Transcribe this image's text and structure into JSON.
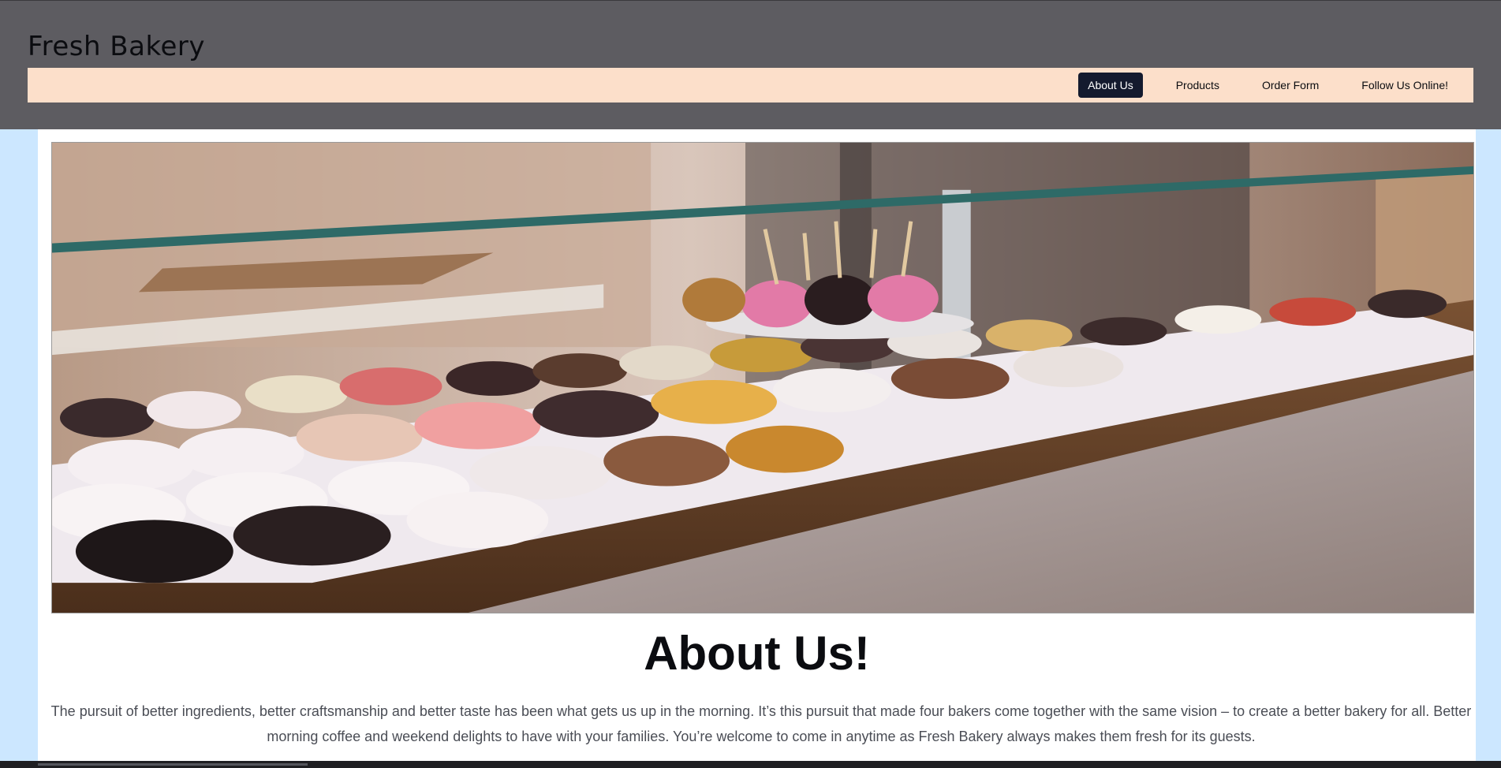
{
  "header": {
    "brand": "Fresh Bakery"
  },
  "nav": {
    "items": [
      {
        "label": "About Us",
        "active": true
      },
      {
        "label": "Products",
        "active": false
      },
      {
        "label": "Order Form",
        "active": false
      },
      {
        "label": "Follow Us Online!",
        "active": false
      }
    ]
  },
  "main": {
    "title": "About Us!",
    "intro": "The pursuit of better ingredients, better craftsmanship and better taste has been what gets us up in the morning. It’s this pursuit that made four bakers come together with the same vision – to create a better bakery for all. Better morning coffee and weekend delights to have with your families. You’re welcome to come in anytime as Fresh Bakery always makes them fresh for its guests."
  },
  "colors": {
    "header_bg": "#5d5c61",
    "nav_bg": "#fcdfca",
    "nav_active_bg": "#141a2e",
    "page_bg": "#cce7ff"
  }
}
